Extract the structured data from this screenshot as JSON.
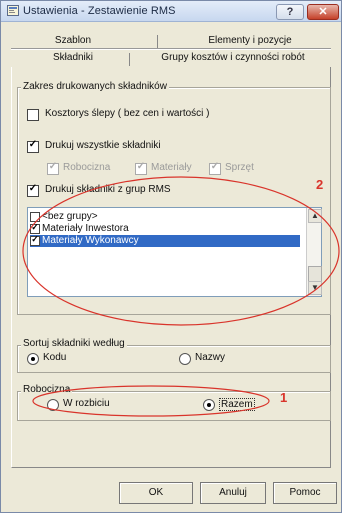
{
  "window": {
    "title": "Ustawienia - Zestawienie RMS",
    "help_label": "?",
    "close_label": "✕"
  },
  "tabs": {
    "row1": [
      "Szablon",
      "Elementy i pozycje"
    ],
    "row2": [
      "Składniki",
      "Grupy kosztów i czynności robót"
    ],
    "active": "Składniki"
  },
  "zakres": {
    "legend": "Zakres drukowanych składników",
    "koszt_slepy": {
      "label": "Kosztorys ślepy ( bez cen i wartości )",
      "checked": false
    },
    "drukuj_wszystkie": {
      "label": "Drukuj wszystkie składniki",
      "checked": true
    },
    "sub_options": [
      {
        "label": "Robocizna",
        "checked": true
      },
      {
        "label": "Materiały",
        "checked": true
      },
      {
        "label": "Sprzęt",
        "checked": true
      }
    ],
    "drukuj_grupy": {
      "label": "Drukuj składniki z grup RMS",
      "checked": true
    }
  },
  "groups_list": {
    "items": [
      {
        "label": "<bez grupy>",
        "checked": false,
        "selected": false
      },
      {
        "label": "Materiały Inwestora",
        "checked": true,
        "selected": false
      },
      {
        "label": "Materiały Wykonawcy",
        "checked": true,
        "selected": true
      }
    ]
  },
  "sortuj": {
    "legend": "Sortuj składniki według",
    "options": [
      {
        "label": "Kodu",
        "selected": true
      },
      {
        "label": "Nazwy",
        "selected": false
      }
    ]
  },
  "robocizna": {
    "legend": "Robocizna",
    "options": [
      {
        "label": "W rozbiciu",
        "selected": false
      },
      {
        "label": "Razem",
        "selected": true
      }
    ]
  },
  "buttons": {
    "ok": "OK",
    "cancel": "Anuluj",
    "help": "Pomoc"
  },
  "annotations": {
    "marker_1": "1",
    "marker_2": "2",
    "color": "#d9342b"
  }
}
